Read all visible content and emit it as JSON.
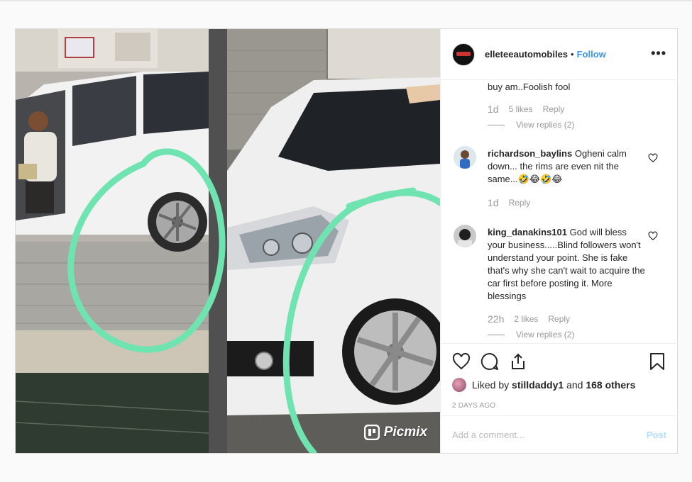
{
  "post": {
    "username": "elleteeautomobiles",
    "separator": "•",
    "follow_label": "Follow",
    "more_label": "•••",
    "watermark": "Picmix"
  },
  "comments": [
    {
      "text": "buy am..Foolish fool",
      "time": "1d",
      "likes": "5 likes",
      "reply": "Reply",
      "view_replies": "View replies (2)"
    },
    {
      "username": "richardson_baylins",
      "text": "Ogheni calm down... the rims are even nit the same...🤣😂🤣😂",
      "time": "1d",
      "reply": "Reply"
    },
    {
      "username": "king_danakins101",
      "text": "God will bless your business.....Blind followers won't understand your point. She is fake that's why she can't wait to acquire the car first before posting it. More blessings",
      "time": "22h",
      "likes": "2 likes",
      "reply": "Reply",
      "view_replies": "View replies (2)"
    }
  ],
  "likes": {
    "prefix": "Liked by",
    "user": "stilldaddy1",
    "middle": "and",
    "others": "168 others"
  },
  "date": "2 DAYS AGO",
  "add_comment": {
    "placeholder": "Add a comment...",
    "post_label": "Post"
  },
  "colors": {
    "accent": "#3897f0",
    "highlight_circle": "#6fe3b0"
  }
}
